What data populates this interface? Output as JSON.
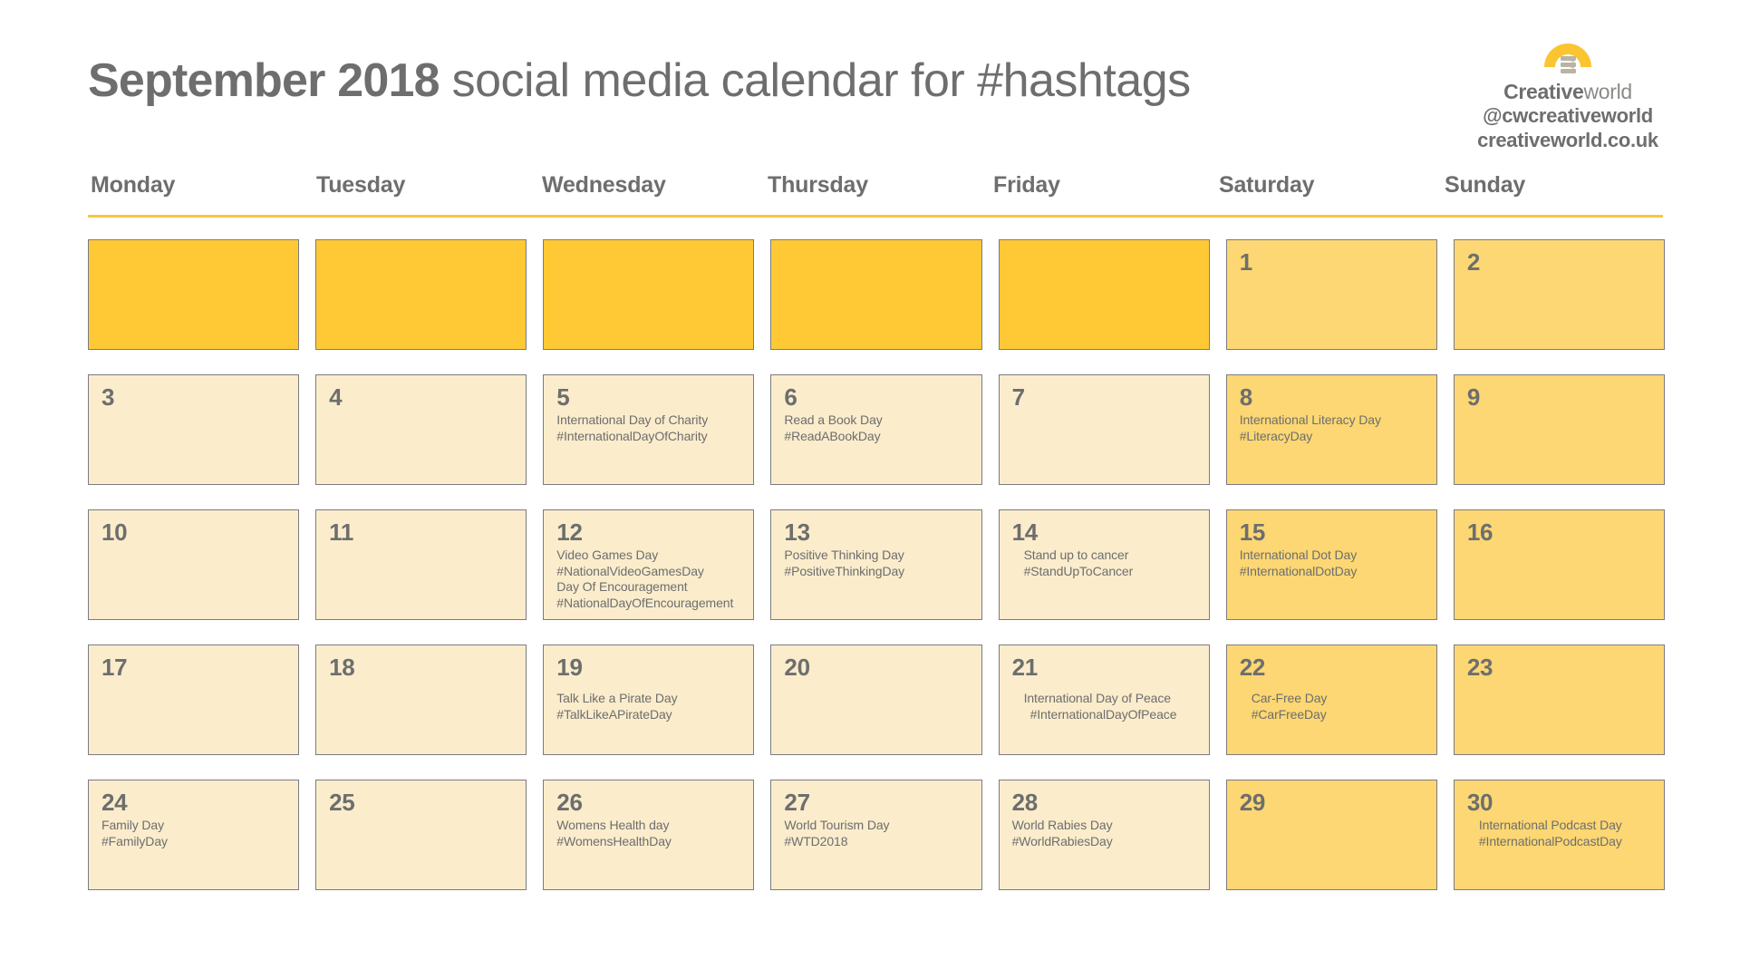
{
  "header": {
    "title_month": "September 2018",
    "title_rest": " social media calendar for #hashtags",
    "brand": {
      "name_bold": "Creative",
      "name_light": "world",
      "handle": "@cwcreativeworld",
      "url": "creativeworld.co.uk",
      "logo_icon": "lightbulb-icon"
    }
  },
  "colors": {
    "accent_yellow": "#FFC935",
    "weekend_yellow": "#FCD773",
    "weekday_cream": "#FBECCC",
    "rule_yellow": "#F9C63F",
    "text_gray": "#6D6E6D",
    "border_gray": "#7B7B82"
  },
  "weekdays": [
    "Monday",
    "Tuesday",
    "Wednesday",
    "Thursday",
    "Friday",
    "Saturday",
    "Sunday"
  ],
  "cells": [
    {
      "day": "",
      "kind": "empty",
      "events": []
    },
    {
      "day": "",
      "kind": "empty",
      "events": []
    },
    {
      "day": "",
      "kind": "empty",
      "events": []
    },
    {
      "day": "",
      "kind": "empty",
      "events": []
    },
    {
      "day": "",
      "kind": "empty",
      "events": []
    },
    {
      "day": "1",
      "kind": "weekend",
      "events": []
    },
    {
      "day": "2",
      "kind": "weekend",
      "events": []
    },
    {
      "day": "3",
      "kind": "weekday",
      "events": []
    },
    {
      "day": "4",
      "kind": "weekday",
      "events": []
    },
    {
      "day": "5",
      "kind": "weekday",
      "events": [
        "International Day of Charity",
        "#InternationalDayOfCharity"
      ]
    },
    {
      "day": "6",
      "kind": "weekday",
      "events": [
        "Read a Book Day",
        "#ReadABookDay"
      ]
    },
    {
      "day": "7",
      "kind": "weekday",
      "events": []
    },
    {
      "day": "8",
      "kind": "weekend",
      "events": [
        "International Literacy Day",
        "#LiteracyDay"
      ]
    },
    {
      "day": "9",
      "kind": "weekend",
      "events": []
    },
    {
      "day": "10",
      "kind": "weekday",
      "events": []
    },
    {
      "day": "11",
      "kind": "weekday",
      "events": []
    },
    {
      "day": "12",
      "kind": "weekday",
      "events": [
        "Video Games Day",
        "#NationalVideoGamesDay",
        "Day Of Encouragement",
        "#NationalDayOfEncouragement"
      ]
    },
    {
      "day": "13",
      "kind": "weekday",
      "events": [
        "Positive Thinking Day",
        "#PositiveThinkingDay"
      ]
    },
    {
      "day": "14",
      "kind": "weekday",
      "indent": true,
      "events": [
        "Stand up to cancer",
        "#StandUpToCancer"
      ]
    },
    {
      "day": "15",
      "kind": "weekend",
      "events": [
        "International Dot Day",
        "#InternationalDotDay"
      ]
    },
    {
      "day": "16",
      "kind": "weekend",
      "events": []
    },
    {
      "day": "17",
      "kind": "weekday",
      "events": []
    },
    {
      "day": "18",
      "kind": "weekday",
      "events": []
    },
    {
      "day": "19",
      "kind": "weekday",
      "pad_top": true,
      "events": [
        "Talk Like a Pirate Day",
        "#TalkLikeAPirateDay"
      ]
    },
    {
      "day": "20",
      "kind": "weekday",
      "events": []
    },
    {
      "day": "21",
      "kind": "weekday",
      "pad_top": true,
      "indent": true,
      "events": [
        "International Day of Peace",
        "#InternationalDayOfPeace"
      ]
    },
    {
      "day": "22",
      "kind": "weekend",
      "pad_top": true,
      "indent": true,
      "events": [
        "Car-Free Day",
        "#CarFreeDay"
      ]
    },
    {
      "day": "23",
      "kind": "weekend",
      "events": []
    },
    {
      "day": "24",
      "kind": "weekday",
      "events": [
        "Family Day",
        "#FamilyDay"
      ]
    },
    {
      "day": "25",
      "kind": "weekday",
      "events": []
    },
    {
      "day": "26",
      "kind": "weekday",
      "events": [
        "Womens Health day",
        "#WomensHealthDay"
      ]
    },
    {
      "day": "27",
      "kind": "weekday",
      "events": [
        "World Tourism Day",
        "#WTD2018"
      ]
    },
    {
      "day": "28",
      "kind": "weekday",
      "events": [
        "World Rabies Day",
        "#WorldRabiesDay"
      ]
    },
    {
      "day": "29",
      "kind": "weekend",
      "events": []
    },
    {
      "day": "30",
      "kind": "weekend",
      "indent": true,
      "events": [
        "International Podcast Day",
        "#InternationalPodcastDay"
      ]
    }
  ]
}
